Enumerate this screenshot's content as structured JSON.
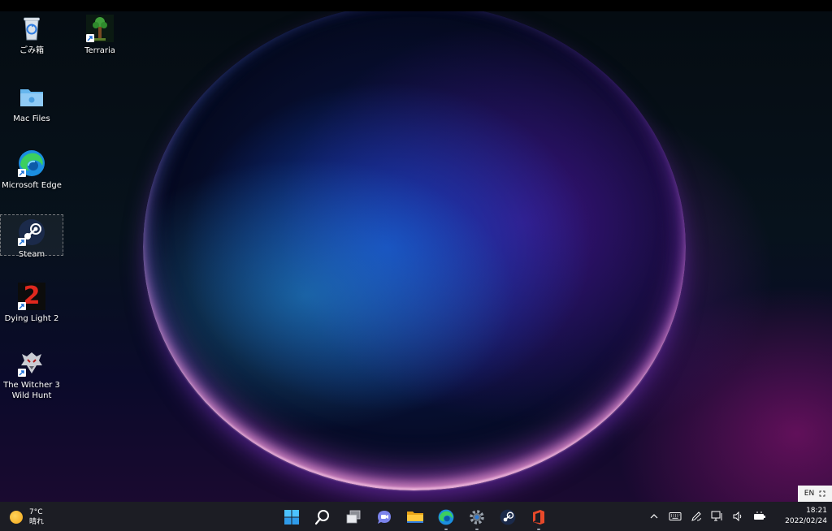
{
  "desktop": {
    "icons": [
      {
        "id": "recycle-bin",
        "label": "ごみ箱",
        "shortcut": false
      },
      {
        "id": "terraria",
        "label": "Terraria",
        "shortcut": true
      },
      {
        "id": "mac-files",
        "label": "Mac Files",
        "shortcut": false
      },
      {
        "id": "microsoft-edge",
        "label": "Microsoft Edge",
        "shortcut": true
      },
      {
        "id": "steam",
        "label": "Steam",
        "shortcut": true,
        "selected": true
      },
      {
        "id": "dying-light-2",
        "label": "Dying Light 2",
        "shortcut": true,
        "glyph_text": "2"
      },
      {
        "id": "witcher-3",
        "label_line1": "The Witcher 3",
        "label_line2": "Wild Hunt",
        "shortcut": true
      }
    ]
  },
  "taskbar": {
    "weather": {
      "temperature": "7°C",
      "condition": "晴れ",
      "icon": "sun-icon"
    },
    "pinned": [
      {
        "name": "start-button",
        "icon": "windows-logo-icon",
        "running": false
      },
      {
        "name": "search-button",
        "icon": "search-icon",
        "running": false
      },
      {
        "name": "task-view-button",
        "icon": "task-view-icon",
        "running": false
      },
      {
        "name": "chat-button",
        "icon": "teams-chat-icon",
        "running": false
      },
      {
        "name": "file-explorer-button",
        "icon": "folder-icon",
        "running": false
      },
      {
        "name": "edge-button",
        "icon": "edge-icon",
        "running": true
      },
      {
        "name": "settings-button",
        "icon": "gear-icon",
        "running": true
      },
      {
        "name": "steam-button",
        "icon": "steam-icon",
        "running": false
      },
      {
        "name": "office-button",
        "icon": "office-icon",
        "running": true
      }
    ],
    "tray": {
      "icons": [
        "chevron-up-icon",
        "keyboard-icon",
        "pen-icon",
        "network-icon",
        "speaker-icon",
        "battery-icon"
      ],
      "time": "18:21",
      "date": "2022/02/24"
    },
    "ime": {
      "label": "EN"
    }
  },
  "colors": {
    "taskbar_bg": "#1c1d24",
    "accent_blue": "#2f7de1",
    "office_red": "#e8492a"
  }
}
